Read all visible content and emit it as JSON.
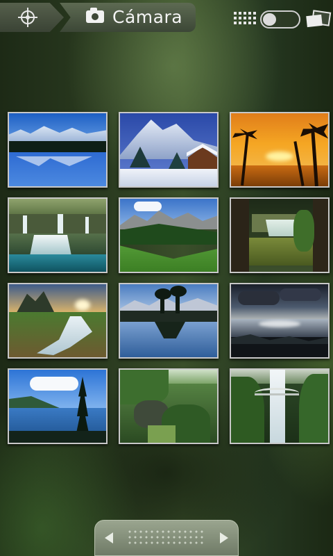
{
  "header": {
    "title": "Cámara",
    "location_icon": "location-target-icon",
    "camera_icon": "camera-icon",
    "grid_icon": "grid-view-icon",
    "toggle_state": "off",
    "stack_icon": "photo-stack-icon"
  },
  "gallery": {
    "columns": 3,
    "rows": 4,
    "items": [
      {
        "scene": "snowy-mountain-lake"
      },
      {
        "scene": "snow-cabin"
      },
      {
        "scene": "palm-sunset"
      },
      {
        "scene": "cascading-waterfalls"
      },
      {
        "scene": "alpine-meadow"
      },
      {
        "scene": "forest-waterfall"
      },
      {
        "scene": "mountain-stream-sunset"
      },
      {
        "scene": "mountain-reflection-lake"
      },
      {
        "scene": "dark-sea-clouds"
      },
      {
        "scene": "lake-pine-tree"
      },
      {
        "scene": "green-valley-rocks"
      },
      {
        "scene": "tall-waterfall-bridge"
      }
    ]
  },
  "bottom_nav": {
    "left_icon": "arrow-left-icon",
    "right_icon": "arrow-right-icon"
  },
  "colors": {
    "thumb_border": "#c8c8c8",
    "bar_bg": "#8e9984",
    "text": "#f4f4f4"
  }
}
